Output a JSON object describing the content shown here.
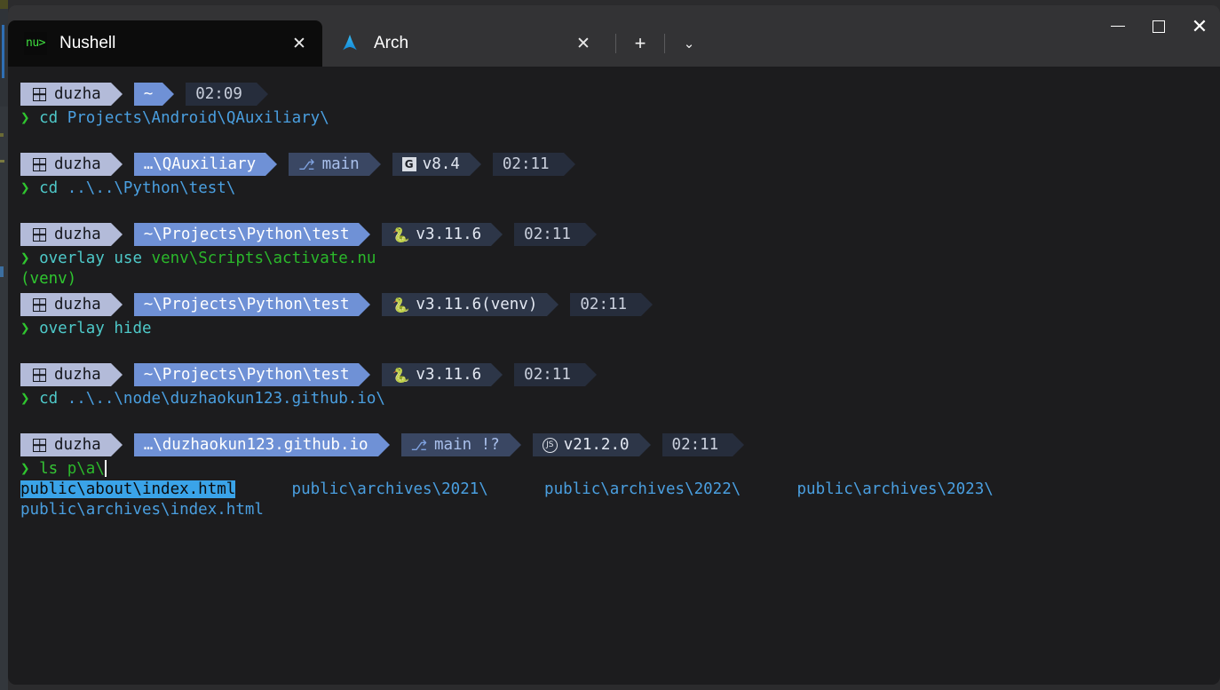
{
  "window": {
    "controls": {
      "minimize_label": "–",
      "maximize_label": "☐",
      "close_label": "✕"
    }
  },
  "tabstrip": {
    "tabs": [
      {
        "title": "Nushell",
        "icon": "nushell-icon",
        "icon_text": "nu>",
        "close_label": "✕",
        "active": true
      },
      {
        "title": "Arch",
        "icon": "arch-linux-icon",
        "close_label": "✕",
        "active": false
      }
    ],
    "new_tab_label": "+",
    "dropdown_label": "⌄"
  },
  "terminal": {
    "blocks": [
      {
        "prompt": {
          "user": "duzha",
          "path": "~",
          "git": null,
          "tool": null,
          "time": "02:09"
        },
        "command": {
          "chevron": "❯",
          "cmd": "cd",
          "arg": "Projects\\Android\\QAuxiliary\\"
        },
        "output": []
      },
      {
        "prompt": {
          "user": "duzha",
          "path": "…\\QAuxiliary",
          "git": "main",
          "tool": "v8.4",
          "tool_icon": "gradle-icon",
          "time": "02:11"
        },
        "command": {
          "chevron": "❯",
          "cmd": "cd",
          "arg": "..\\..\\Python\\test\\"
        },
        "output": []
      },
      {
        "prompt": {
          "user": "duzha",
          "path": "~\\Projects\\Python\\test",
          "git": null,
          "tool": "v3.11.6",
          "tool_icon": "python-icon",
          "time": "02:11"
        },
        "command": {
          "chevron": "❯",
          "cmd": "overlay use",
          "arg": "venv\\Scripts\\activate.nu"
        },
        "output": [
          "(venv)"
        ]
      },
      {
        "prompt": {
          "user": "duzha",
          "path": "~\\Projects\\Python\\test",
          "git": null,
          "tool": "v3.11.6(venv)",
          "tool_icon": "python-icon",
          "time": "02:11"
        },
        "command": {
          "chevron": "❯",
          "cmd": "overlay hide",
          "arg": ""
        },
        "output": []
      },
      {
        "prompt": {
          "user": "duzha",
          "path": "~\\Projects\\Python\\test",
          "git": null,
          "tool": "v3.11.6",
          "tool_icon": "python-icon",
          "time": "02:11"
        },
        "command": {
          "chevron": "❯",
          "cmd": "cd",
          "arg": "..\\..\\node\\duzhaokun123.github.io\\"
        },
        "output": []
      },
      {
        "prompt": {
          "user": "duzha",
          "path": "…\\duzhaokun123.github.io",
          "git": "main !?",
          "tool": "v21.2.0",
          "tool_icon": "nodejs-icon",
          "time": "02:11"
        },
        "command": {
          "chevron": "❯",
          "cmd": "ls",
          "arg": "p\\a\\"
        },
        "output": []
      }
    ],
    "completions": {
      "row1": [
        {
          "text": "public\\about\\index.html",
          "selected": true
        },
        {
          "text": "public\\archives\\2021\\",
          "selected": false
        },
        {
          "text": "public\\archives\\2022\\",
          "selected": false
        },
        {
          "text": "public\\archives\\2023\\",
          "selected": false
        }
      ],
      "row2": [
        {
          "text": "public\\archives\\index.html",
          "selected": false
        }
      ]
    }
  },
  "colors": {
    "terminal_bg": "#1c1c1e",
    "titlebar_bg": "#333335",
    "active_tab_bg": "#0c0c0c",
    "segment_user": "#b3bbd9",
    "segment_path": "#6f91d6",
    "segment_git": "#3a4763",
    "segment_tool": "#2d3648",
    "segment_time": "#262d3c",
    "completion_selected": "#3aa3e8",
    "completion_text": "#4a9fe0",
    "prompt_green": "#2fc52f",
    "command_cyan": "#4ec9c9"
  }
}
